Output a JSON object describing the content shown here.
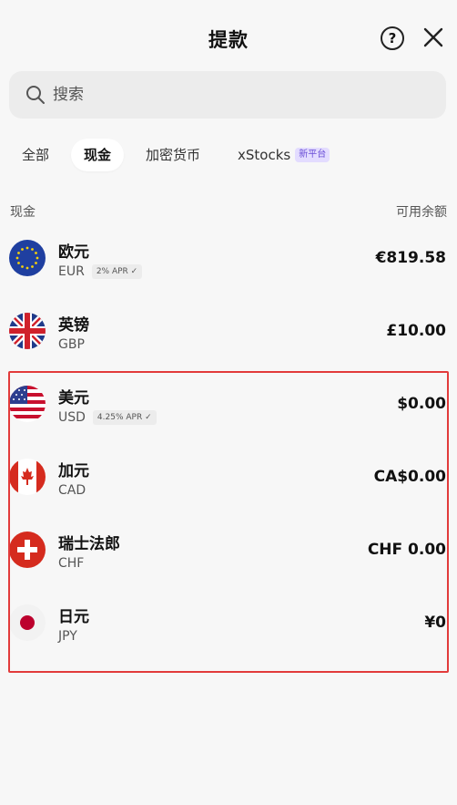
{
  "header": {
    "title": "提款",
    "help_icon": "?",
    "close_label": "close"
  },
  "search": {
    "placeholder": "搜索"
  },
  "tabs": [
    {
      "label": "全部",
      "active": false
    },
    {
      "label": "现金",
      "active": true
    },
    {
      "label": "加密货币",
      "active": false
    },
    {
      "label": "xStocks",
      "active": false,
      "badge": "新平台"
    }
  ],
  "list_header": {
    "left": "现金",
    "right": "可用余额"
  },
  "currencies": [
    {
      "name": "欧元",
      "code": "EUR",
      "apr": "2% APR ✓",
      "amount": "€819.58",
      "flag": "eu-flag-icon"
    },
    {
      "name": "英镑",
      "code": "GBP",
      "amount": "£10.00",
      "flag": "uk-flag-icon"
    },
    {
      "name": "美元",
      "code": "USD",
      "apr": "4.25% APR ✓",
      "amount": "$0.00",
      "flag": "us-flag-icon"
    },
    {
      "name": "加元",
      "code": "CAD",
      "amount": "CA$0.00",
      "flag": "canada-flag-icon"
    },
    {
      "name": "瑞士法郎",
      "code": "CHF",
      "amount": "CHF 0.00",
      "flag": "swiss-flag-icon"
    },
    {
      "name": "日元",
      "code": "JPY",
      "amount": "¥0",
      "flag": "japan-flag-icon"
    }
  ],
  "colors": {
    "highlight": "#e23b3b",
    "badge_bg": "#e3dcff",
    "badge_text": "#6a4ed6"
  }
}
